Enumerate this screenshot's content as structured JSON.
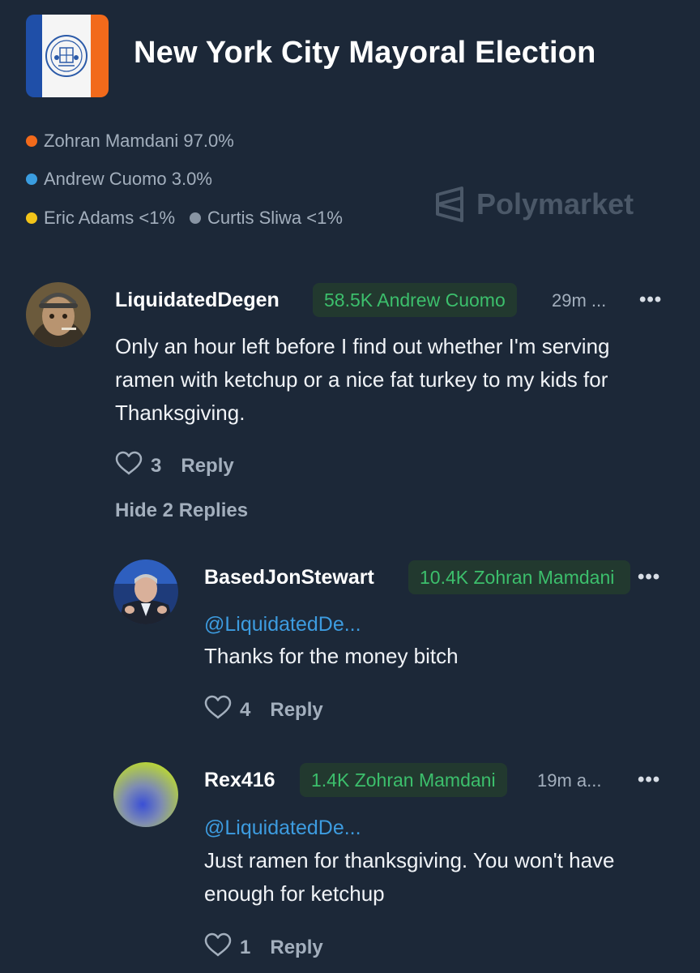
{
  "market": {
    "title": "New York City Mayoral Election",
    "outcomes": [
      {
        "label": "Zohran Mamdani 97.0%",
        "color": "#f26a1b"
      },
      {
        "label": "Andrew Cuomo 3.0%",
        "color": "#3a9de0"
      },
      {
        "label": "Eric Adams <1%",
        "color": "#f2c419"
      },
      {
        "label": "Curtis Sliwa <1%",
        "color": "#8894a3"
      }
    ],
    "watermark": "Polymarket"
  },
  "comments": [
    {
      "username": "LiquidatedDegen",
      "position": "58.5K Andrew Cuomo",
      "time": "29m ...",
      "more": "•••",
      "text": "Only an hour left before I find out whether I'm serving ramen with ketchup or a nice fat turkey to my kids for Thanksgiving.",
      "likes": "3",
      "reply_label": "Reply",
      "hide_replies": "Hide 2 Replies"
    },
    {
      "username": "BasedJonStewart",
      "position": "10.4K Zohran Mamdani",
      "more": "•••",
      "mention": "@LiquidatedDe...",
      "text": "Thanks for the money bitch",
      "likes": "4",
      "reply_label": "Reply"
    },
    {
      "username": "Rex416",
      "position": "1.4K Zohran Mamdani",
      "time": "19m a...",
      "more": "•••",
      "mention": "@LiquidatedDe...",
      "text": "Just ramen for thanksgiving. You won't have enough for ketchup",
      "likes": "1",
      "reply_label": "Reply"
    }
  ]
}
